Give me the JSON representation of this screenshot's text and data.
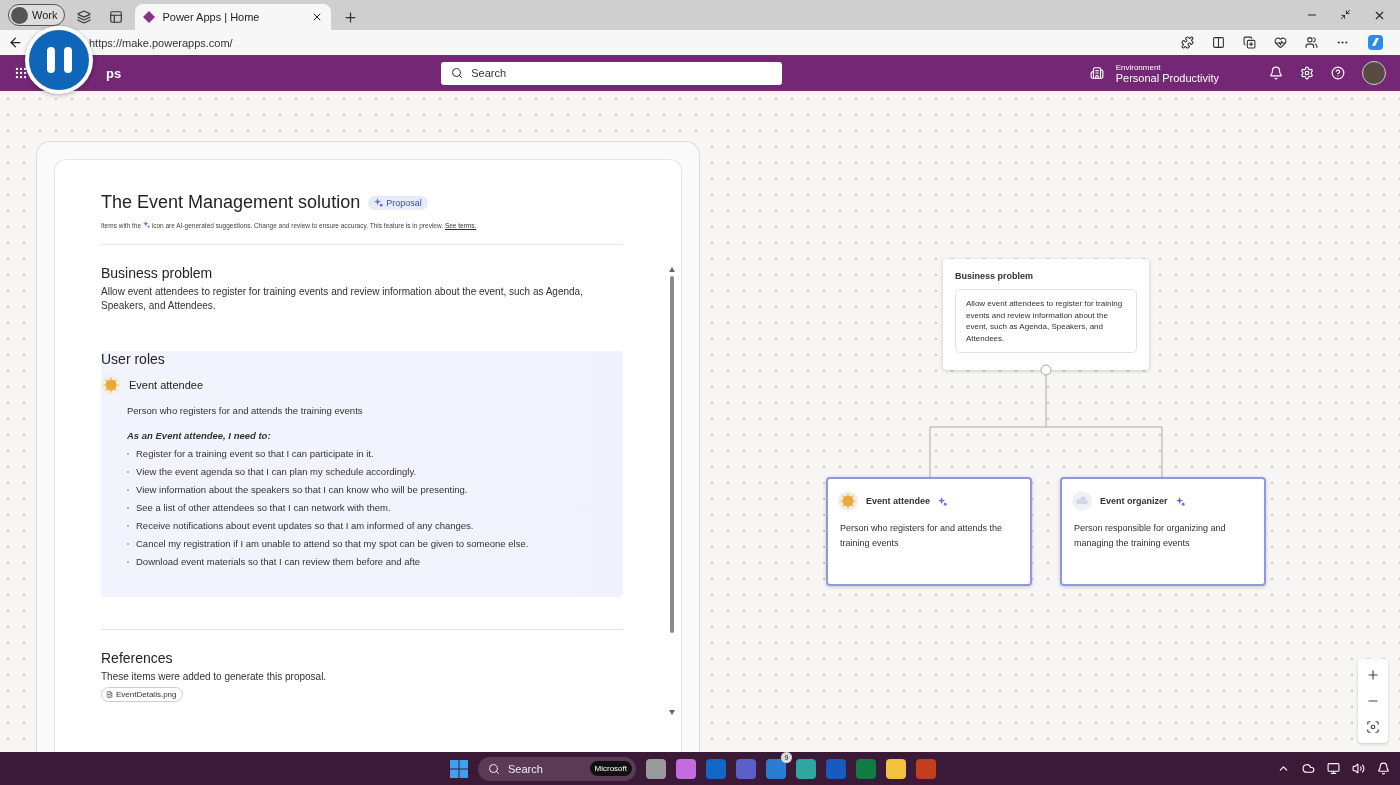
{
  "browser": {
    "profile": {
      "label": "Work"
    },
    "tabs": [
      {
        "label": "Power Apps | Home",
        "selected": true
      }
    ],
    "url": "https://make.powerapps.com/"
  },
  "recording": {
    "paused": true
  },
  "header": {
    "app_title": "ps",
    "search": {
      "placeholder": "Search"
    },
    "environment": {
      "label": "Environment",
      "name": "Personal Productivity"
    }
  },
  "proposal": {
    "title": "The Event Management solution",
    "badge": "Proposal",
    "notice": {
      "before": "Items with the",
      "after": "icon are AI-generated suggestions. Change and review to ensure accuracy. This feature is in preview.",
      "link": "See terms."
    },
    "business_problem": {
      "heading": "Business problem",
      "text": "Allow event attendees to register for training events and review information about the event, such as Agenda, Speakers, and Attendees."
    },
    "user_roles": {
      "heading": "User roles",
      "roles": [
        {
          "name": "Event attendee",
          "description": "Person who registers for and attends the training events",
          "needs_heading": "As an Event attendee, I need to:",
          "needs": [
            "Register for a training event so that I can participate in it.",
            "View the event agenda so that I can plan my schedule accordingly.",
            "View information about the speakers so that I can know who will be presenting.",
            "See a list of other attendees so that I can network with them.",
            "Receive notifications about event updates so that I am informed of any changes.",
            "Cancel my registration if I am unable to attend so that my spot can be given to someone else.",
            "Download event materials so that I can review them before and afte"
          ]
        }
      ]
    },
    "references": {
      "heading": "References",
      "text": "These items were added to generate this proposal.",
      "files": [
        "EventDetails.png"
      ]
    }
  },
  "diagram": {
    "root": {
      "title": "Business problem",
      "text": "Allow event attendees to register for training events and review information about the event, such as Agenda, Speakers, and Attendees."
    },
    "roles": [
      {
        "name": "Event attendee",
        "description": "Person who registers for and attends the training events",
        "ai": true
      },
      {
        "name": "Event organizer",
        "description": "Person responsible for organizing and managing the training events",
        "ai": true
      }
    ]
  },
  "taskbar": {
    "search": {
      "placeholder": "Search"
    },
    "chip": "Microsoft",
    "badge": "9"
  }
}
